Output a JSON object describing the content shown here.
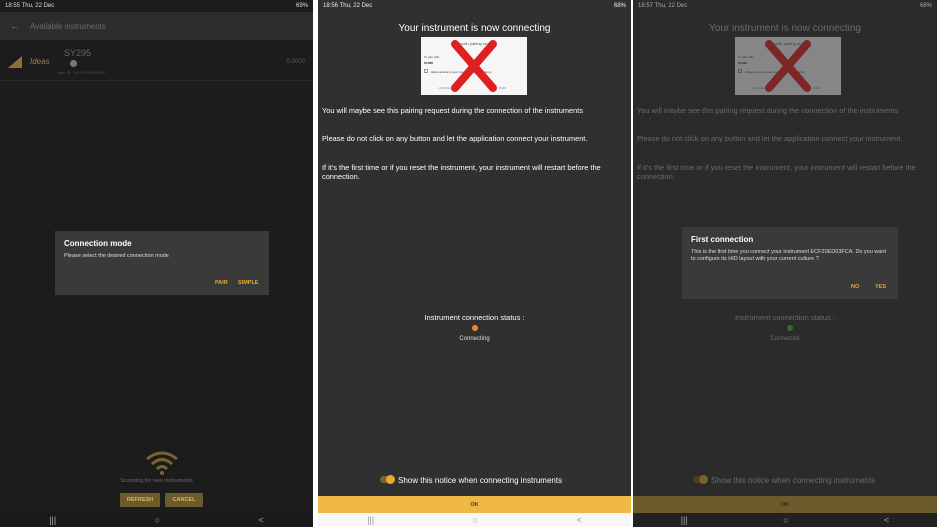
{
  "panel1": {
    "status": {
      "time": "18:55",
      "date": "Thu, 22 Dec",
      "right": "69%"
    },
    "appbar": {
      "title": "Available instruments"
    },
    "instrument": {
      "name": "SY295",
      "logo": "Ideas",
      "mac": "Mac ID : XX:XX:XX:XX:XX",
      "value": "0.0000"
    },
    "dialog": {
      "title": "Connection mode",
      "message": "Please select the desired connection mode",
      "pair": "PAIR",
      "simple": "SIMPLE"
    },
    "scanning": "Scanning for new instruments",
    "refresh": "REFRESH",
    "cancel": "CANCEL"
  },
  "panel2": {
    "status": {
      "time": "18:56",
      "date": "Thu, 22 Dec",
      "right": "68%"
    },
    "heading": "Your instrument is now connecting",
    "pairing": {
      "title": "Bluetooth pairing request",
      "line1": "To pair with:",
      "device": "SY295",
      "allow": "Allow access to your contacts and call history",
      "cancel": "CANCEL",
      "pair": "PAIR"
    },
    "para1": "You will maybe see this pairing request during the connection of the instruments",
    "para2": "Please do not click on any button and let the application connect your instrument.",
    "para3": "If it's the first time or if you reset the instrument, your instrument will restart before the connection.",
    "status_label": "Instrument connection status :",
    "status_text": "Connecting",
    "toggle_text": "Show this notice when connecting instruments",
    "ok": "OK"
  },
  "panel3": {
    "status": {
      "time": "18:57",
      "date": "Thu, 22 Dec",
      "right": "68%"
    },
    "heading": "Your instrument is now connecting",
    "para1": "You will maybe see this pairing request during the connection of the instruments",
    "para2": "Please do not click on any button and let the application connect your instrument.",
    "para3": "If it's the first time or if you reset the instrument, your instrument will restart before the connection.",
    "dialog": {
      "title": "First connection",
      "message": "This is the first time you connect your instrument ECF20ED03FCA. Do you want to configure its HID layout with your current culture ?",
      "no": "NO",
      "yes": "YES"
    },
    "status_label": "Instrument connection status :",
    "status_text": "Connected",
    "toggle_text": "Show this notice when connecting instruments",
    "ok": "OK"
  },
  "colors": {
    "accent": "#e8a93a",
    "connecting": "#f08a24",
    "connected": "#2e8b3a"
  },
  "nav": {
    "recents": "|||",
    "home": "○",
    "back": "<"
  }
}
